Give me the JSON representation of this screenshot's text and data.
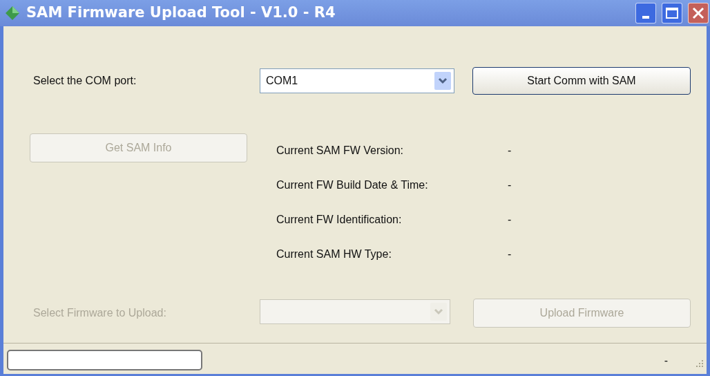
{
  "window": {
    "title": "SAM Firmware Upload Tool - V1.0 - R4"
  },
  "com_port": {
    "label": "Select the COM port:",
    "value": "COM1",
    "disabled": false
  },
  "start_button": {
    "label": "Start Comm with SAM",
    "disabled": false
  },
  "info_button": {
    "label": "Get SAM Info",
    "disabled": true
  },
  "info": [
    {
      "label": "Current SAM FW Version:",
      "value": "-"
    },
    {
      "label": "Current FW Build Date & Time:",
      "value": "-"
    },
    {
      "label": "Current FW Identification:",
      "value": "-"
    },
    {
      "label": "Current SAM HW Type:",
      "value": "-"
    }
  ],
  "firmware": {
    "label": "Select Firmware to Upload:",
    "disabled": true
  },
  "upload_button": {
    "label": "Upload Firmware",
    "disabled": true
  },
  "status_bar": {
    "text": "-"
  }
}
